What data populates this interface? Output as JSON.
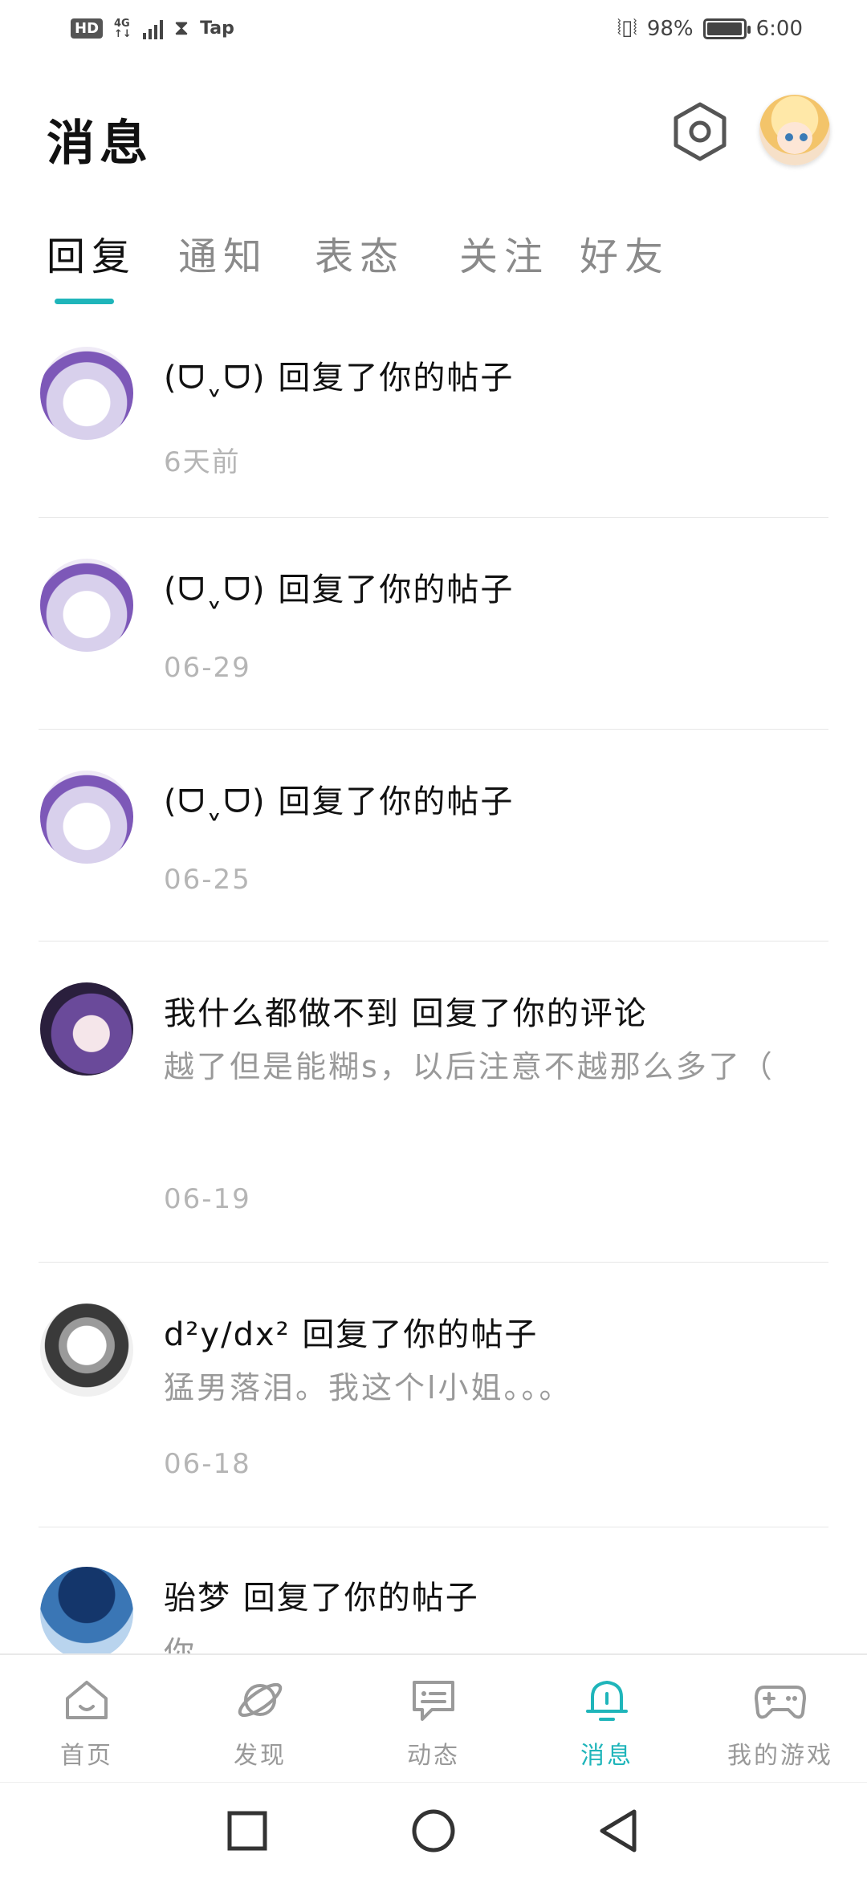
{
  "status_bar": {
    "hd": "HD",
    "network": "4G",
    "carrier_app": "Tap",
    "battery": "98%",
    "battery_fraction": 0.98,
    "time": "6:00"
  },
  "header": {
    "title": "消息",
    "settings_icon": "hexagon-settings-icon",
    "avatar_icon": "user-avatar"
  },
  "tabs": [
    {
      "label": "回复",
      "active": true
    },
    {
      "label": "通知",
      "active": false
    },
    {
      "label": "表态",
      "active": false
    },
    {
      "label": "关注",
      "active": false
    },
    {
      "label": "好友",
      "active": false
    }
  ],
  "accent_color": "#1fb5ba",
  "messages": [
    {
      "title": "(ᗜˬᗜ) 回复了你的帖子",
      "snippet": "",
      "time": "6天前"
    },
    {
      "title": "(ᗜˬᗜ) 回复了你的帖子",
      "snippet": "",
      "time": "06-29"
    },
    {
      "title": "(ᗜˬᗜ) 回复了你的帖子",
      "snippet": "",
      "time": "06-25"
    },
    {
      "title": "我什么都做不到 回复了你的评论",
      "snippet": "越了但是能糊s，以后注意不越那么多了（",
      "time": "06-19"
    },
    {
      "title": "d²y/dx² 回复了你的帖子",
      "snippet": "猛男落泪。我这个l小姐。。。",
      "time": "06-18"
    },
    {
      "title": "骀梦 回复了你的帖子",
      "snippet": "你",
      "time": ""
    }
  ],
  "bottom_nav": [
    {
      "label": "首页",
      "icon": "home-icon",
      "active": false
    },
    {
      "label": "发现",
      "icon": "planet-icon",
      "active": false
    },
    {
      "label": "动态",
      "icon": "chat-icon",
      "active": false
    },
    {
      "label": "消息",
      "icon": "bell-icon",
      "active": true
    },
    {
      "label": "我的游戏",
      "icon": "gamepad-icon",
      "active": false
    }
  ],
  "system_nav": {
    "recent": "square-icon",
    "home": "circle-icon",
    "back": "triangle-back-icon"
  }
}
